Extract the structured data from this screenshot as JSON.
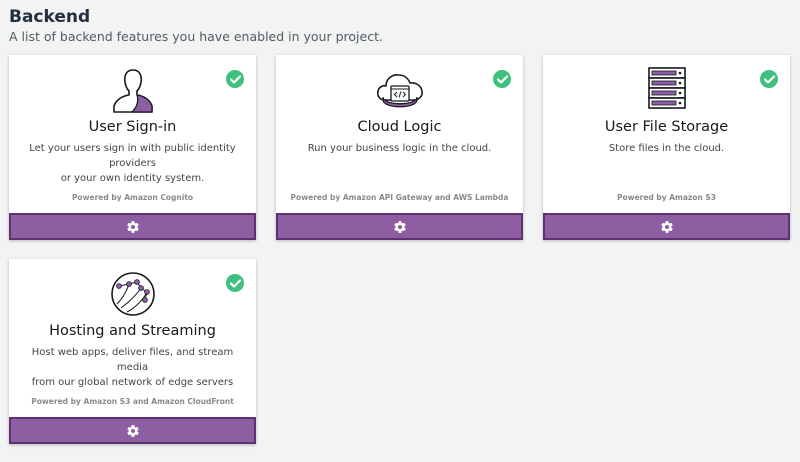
{
  "header": {
    "title": "Backend",
    "subtitle": "A list of backend features you have enabled in your project."
  },
  "colors": {
    "accent": "#8e5ea3",
    "accent_border": "#5e3272",
    "enabled_check": "#3ec17c"
  },
  "cards": [
    {
      "icon": "user-silhouette-icon",
      "name": "User Sign-in",
      "description_line1": "Let your users sign in with public identity providers",
      "description_line2": "or your own identity system.",
      "powered_by": "Powered by Amazon Cognito",
      "enabled": true
    },
    {
      "icon": "cloud-code-icon",
      "name": "Cloud Logic",
      "description_line1": "Run your business logic in the cloud.",
      "description_line2": "",
      "powered_by": "Powered by Amazon API Gateway and AWS Lambda",
      "enabled": true
    },
    {
      "icon": "server-rack-icon",
      "name": "User File Storage",
      "description_line1": "Store files in the cloud.",
      "description_line2": "",
      "powered_by": "Powered by Amazon S3",
      "enabled": true
    },
    {
      "icon": "globe-network-icon",
      "name": "Hosting and Streaming",
      "description_line1": "Host web apps, deliver files, and stream media",
      "description_line2": "from our global network of edge servers",
      "powered_by": "Powered by Amazon S3 and Amazon CloudFront",
      "enabled": true
    }
  ]
}
